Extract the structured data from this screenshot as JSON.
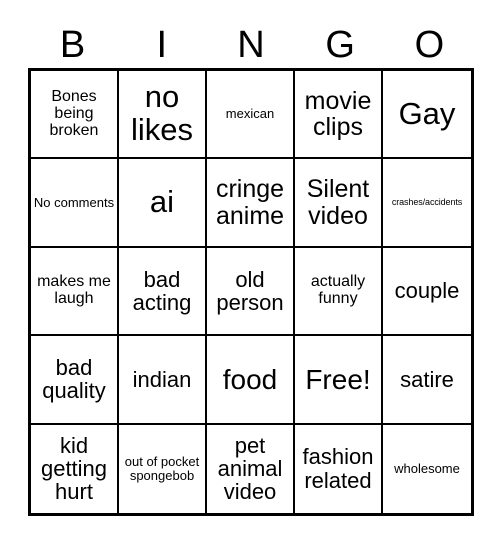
{
  "card": {
    "type": "bingo-card",
    "columns": 5,
    "rows": 5,
    "background_color": "#ffffff",
    "text_color": "#000000",
    "border_color": "#000000",
    "header": {
      "letters": [
        "B",
        "I",
        "N",
        "G",
        "O"
      ]
    },
    "free_space": {
      "label": "Free!",
      "row": 3,
      "column": 3
    },
    "grid": [
      [
        {
          "text": "Bones being broken",
          "size": "sm"
        },
        {
          "text": "no likes",
          "size": "xxl"
        },
        {
          "text": "mexican",
          "size": "xs"
        },
        {
          "text": "movie clips",
          "size": "lg"
        },
        {
          "text": "Gay",
          "size": "xxl"
        }
      ],
      [
        {
          "text": "No comments",
          "size": "xs"
        },
        {
          "text": "ai",
          "size": "xxl"
        },
        {
          "text": "cringe anime",
          "size": "lg"
        },
        {
          "text": "Silent video",
          "size": "lg"
        },
        {
          "text": "crashes/accidents",
          "size": "xxs"
        }
      ],
      [
        {
          "text": "makes me laugh",
          "size": "sm"
        },
        {
          "text": "bad acting",
          "size": "md"
        },
        {
          "text": "old person",
          "size": "md"
        },
        {
          "text": "actually funny",
          "size": "sm"
        },
        {
          "text": "couple",
          "size": "md"
        }
      ],
      [
        {
          "text": "bad quality",
          "size": "md"
        },
        {
          "text": "indian",
          "size": "md"
        },
        {
          "text": "food",
          "size": "xl"
        },
        {
          "text": "Free!",
          "size": "xl"
        },
        {
          "text": "satire",
          "size": "md"
        }
      ],
      [
        {
          "text": "kid getting hurt",
          "size": "md"
        },
        {
          "text": "out of pocket spongebob",
          "size": "xs"
        },
        {
          "text": "pet animal video",
          "size": "md"
        },
        {
          "text": "fashion related",
          "size": "md"
        },
        {
          "text": "wholesome",
          "size": "xs"
        }
      ]
    ]
  }
}
